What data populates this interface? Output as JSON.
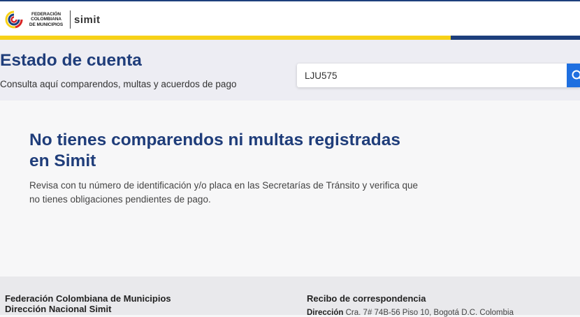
{
  "header": {
    "logo_org_line1": "FEDERACIÓN",
    "logo_org_line2": "COLOMBIANA",
    "logo_org_line3": "DE MUNICIPIOS",
    "logo_brand": "simit"
  },
  "hero": {
    "title": "Estado de cuenta",
    "subtitle": "Consulta aquí comparendos, multas y acuerdos de pago",
    "search_value": "LJU575"
  },
  "result": {
    "title": "No tienes comparendos ni multas registradas en Simit",
    "text": "Revisa con tu número de identificación y/o placa en las Secretarías de Tránsito y verifica que no tienes obligaciones pendientes de pago."
  },
  "footer": {
    "org_name": "Federación Colombiana de Municipios",
    "org_division": "Dirección Nacional Simit",
    "mail_title": "Recibo de correspondencia",
    "address_label": "Dirección",
    "address_value": "Cra. 7# 74B-56 Piso 10, Bogotá D.C. Colombia"
  },
  "colors": {
    "primary": "#1f3d7a",
    "stripe_yellow": "#f7d117",
    "stripe_blue": "#1d3f7c",
    "search_button": "#1e6fe0"
  },
  "icons": {
    "logo": "federacion-logo-icon",
    "search": "search-icon"
  }
}
